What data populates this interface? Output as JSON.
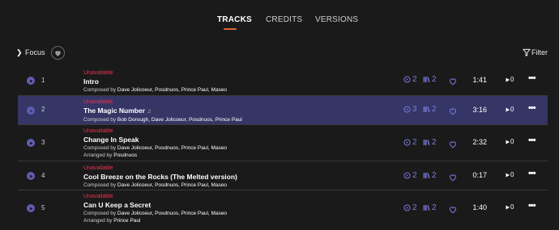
{
  "tabs": [
    {
      "label": "TRACKS",
      "active": true
    },
    {
      "label": "CREDITS",
      "active": false
    },
    {
      "label": "VERSIONS",
      "active": false
    }
  ],
  "toolbar": {
    "focus_label": "Focus",
    "filter_label": "Filter"
  },
  "labels": {
    "composed_by": "Composed by",
    "arranged_by": "Arranged by"
  },
  "colors": {
    "accent": "#7b7be0",
    "unavailable": "#e8334f",
    "active_tab_underline": "#e0643c",
    "selected_row": "#353566"
  },
  "tracks": [
    {
      "number": "1",
      "status": "Unavailable",
      "title": "Intro",
      "composers": "Dave Jolicoeur, Posdnuos, Prince Paul, Maseo",
      "versions": "2",
      "recordings": "2",
      "duration": "1:41",
      "plays": "0",
      "selected": false
    },
    {
      "number": "2",
      "status": "Unavailable",
      "title": "The Magic Number",
      "composers": "Bob Dorough, Dave Jolicoeur, Posdnuos, Prince Paul",
      "versions": "3",
      "recordings": "2",
      "duration": "3:16",
      "plays": "0",
      "selected": true
    },
    {
      "number": "3",
      "status": "Unavailable",
      "title": "Change In Speak",
      "composers": "Dave Jolicoeur, Posdnuos, Prince Paul, Maseo",
      "arrangers": "Posdnuos",
      "versions": "2",
      "recordings": "2",
      "duration": "2:32",
      "plays": "0",
      "selected": false
    },
    {
      "number": "4",
      "status": "Unavailable",
      "title": "Cool Breeze on the Rocks (The Melted version)",
      "composers": "Dave Jolicoeur, Posdnuos, Prince Paul, Maseo",
      "versions": "2",
      "recordings": "2",
      "duration": "0:17",
      "plays": "0",
      "selected": false
    },
    {
      "number": "5",
      "status": "Unavailable",
      "title": "Can U Keep a Secret",
      "composers": "Dave Jolicoeur, Posdnuos, Prince Paul, Maseo",
      "arrangers": "Prince Paul",
      "versions": "2",
      "recordings": "2",
      "duration": "1:40",
      "plays": "0",
      "selected": false
    }
  ]
}
